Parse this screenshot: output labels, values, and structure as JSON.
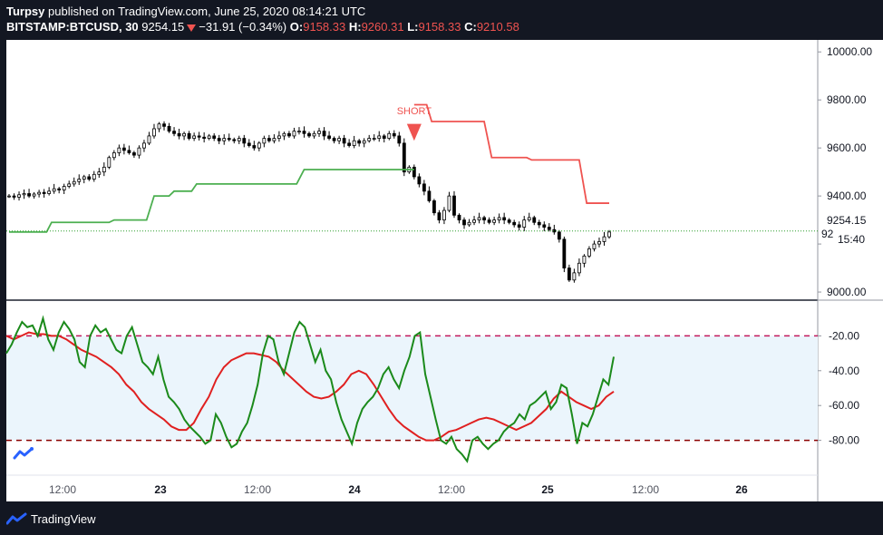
{
  "header": {
    "author": "Turpsy",
    "published": "published on TradingView.com, June 25, 2020 08:14:21 UTC",
    "symbol": "BITSTAMP:BTCUSD, 30",
    "last": "9254.15",
    "change": "−31.91 (−0.34%)",
    "o_label": "O:",
    "o": "9158.33",
    "h_label": "H:",
    "h": "9260.31",
    "l_label": "L:",
    "l": "9158.33",
    "c_label": "C:",
    "c": "9210.58"
  },
  "footer": {
    "brand": "TradingView"
  },
  "colors": {
    "bg": "#131722",
    "up_line": "#4caf50",
    "down_line": "#ef5350",
    "osc_green": "#1b8a1b",
    "osc_red": "#e02020",
    "band": "#ebf5fc",
    "price_line": "#2e9f2e"
  },
  "chart_data": [
    {
      "type": "candlestick",
      "symbol": "BITSTAMP:BTCUSD",
      "interval": "30",
      "ylim": [
        8970,
        10050
      ],
      "y_ticks": [
        9000,
        9200,
        9400,
        9600,
        9800,
        10000
      ],
      "y_tick_labels": [
        "9000.00",
        "",
        "9400.00",
        "9600.00",
        "9800.00",
        "10000.00"
      ],
      "x_ticks": [
        "12:00",
        "23",
        "12:00",
        "24",
        "12:00",
        "25",
        "12:00",
        "26"
      ],
      "last_price_label": "9254.15",
      "countdown_label": "15:40",
      "hidden_label": "92",
      "price_close_series": [
        9400,
        9395,
        9405,
        9410,
        9400,
        9408,
        9415,
        9410,
        9420,
        9430,
        9425,
        9440,
        9450,
        9460,
        9470,
        9480,
        9470,
        9490,
        9500,
        9520,
        9560,
        9580,
        9600,
        9590,
        9580,
        9570,
        9600,
        9620,
        9650,
        9680,
        9700,
        9690,
        9670,
        9660,
        9650,
        9660,
        9640,
        9650,
        9645,
        9640,
        9650,
        9640,
        9630,
        9640,
        9635,
        9630,
        9640,
        9620,
        9610,
        9600,
        9620,
        9640,
        9630,
        9640,
        9650,
        9660,
        9650,
        9670,
        9670,
        9660,
        9650,
        9660,
        9670,
        9650,
        9640,
        9630,
        9640,
        9620,
        9610,
        9630,
        9620,
        9630,
        9640,
        9640,
        9650,
        9640,
        9660,
        9650,
        9620,
        9500,
        9520,
        9480,
        9450,
        9420,
        9380,
        9330,
        9300,
        9340,
        9400,
        9320,
        9300,
        9280,
        9290,
        9300,
        9310,
        9300,
        9290,
        9300,
        9310,
        9300,
        9290,
        9280,
        9270,
        9300,
        9310,
        9290,
        9280,
        9270,
        9260,
        9250,
        9220,
        9100,
        9050,
        9080,
        9120,
        9150,
        9180,
        9200,
        9210,
        9230,
        9250
      ],
      "supertrend_up": {
        "name": "",
        "points": [
          [
            0,
            9250
          ],
          [
            15,
            9250
          ],
          [
            17,
            9290
          ],
          [
            40,
            9290
          ],
          [
            42,
            9300
          ],
          [
            55,
            9300
          ],
          [
            58,
            9400
          ],
          [
            64,
            9400
          ],
          [
            66,
            9420
          ],
          [
            73,
            9420
          ],
          [
            75,
            9450
          ],
          [
            115,
            9450
          ],
          [
            118,
            9510
          ],
          [
            162,
            9510
          ]
        ]
      },
      "supertrend_down": {
        "name": "",
        "points": [
          [
            162,
            9780
          ],
          [
            167,
            9780
          ],
          [
            169,
            9710
          ],
          [
            190,
            9710
          ],
          [
            193,
            9560
          ],
          [
            207,
            9560
          ],
          [
            209,
            9550
          ],
          [
            228,
            9550
          ],
          [
            231,
            9370
          ],
          [
            240,
            9370
          ]
        ]
      },
      "signal_label": "SHORT",
      "signal_x": 162
    },
    {
      "type": "line",
      "name": "oscillator",
      "ylim": [
        -100,
        0
      ],
      "y_ticks": [
        -20,
        -40,
        -60,
        -80
      ],
      "y_tick_labels": [
        "-20.00",
        "-40.00",
        "-60.00",
        "-80.00"
      ],
      "levels": [
        -20,
        -80
      ],
      "fast": [
        -30,
        -25,
        -18,
        -12,
        -15,
        -14,
        -20,
        -10,
        -22,
        -28,
        -18,
        -12,
        -16,
        -22,
        -35,
        -38,
        -20,
        -14,
        -18,
        -16,
        -22,
        -28,
        -30,
        -20,
        -15,
        -25,
        -35,
        -38,
        -42,
        -32,
        -45,
        -55,
        -58,
        -62,
        -68,
        -72,
        -75,
        -78,
        -82,
        -80,
        -65,
        -70,
        -78,
        -84,
        -82,
        -75,
        -70,
        -60,
        -48,
        -30,
        -20,
        -22,
        -35,
        -42,
        -30,
        -18,
        -12,
        -15,
        -25,
        -35,
        -28,
        -40,
        -45,
        -58,
        -68,
        -75,
        -82,
        -70,
        -62,
        -58,
        -55,
        -50,
        -42,
        -38,
        -45,
        -50,
        -40,
        -32,
        -20,
        -18,
        -42,
        -55,
        -68,
        -80,
        -82,
        -78,
        -85,
        -88,
        -92,
        -80,
        -78,
        -82,
        -85,
        -82,
        -80,
        -75,
        -72,
        -70,
        -65,
        -68,
        -60,
        -58,
        -55,
        -52,
        -62,
        -58,
        -48,
        -50,
        -65,
        -82,
        -70,
        -72,
        -65,
        -55,
        -45,
        -48,
        -32
      ],
      "slow": [
        -20,
        -22,
        -20,
        -18,
        -19,
        -19,
        -20,
        -20,
        -22,
        -25,
        -28,
        -30,
        -32,
        -35,
        -38,
        -42,
        -48,
        -52,
        -58,
        -62,
        -65,
        -68,
        -72,
        -74,
        -74,
        -70,
        -62,
        -55,
        -45,
        -38,
        -34,
        -32,
        -30,
        -30,
        -31,
        -32,
        -35,
        -40,
        -44,
        -48,
        -52,
        -55,
        -56,
        -55,
        -52,
        -48,
        -42,
        -40,
        -42,
        -48,
        -55,
        -62,
        -68,
        -72,
        -75,
        -78,
        -80,
        -80,
        -78,
        -75,
        -74,
        -72,
        -70,
        -68,
        -67,
        -68,
        -70,
        -72,
        -74,
        -72,
        -70,
        -66,
        -62,
        -56,
        -52,
        -55,
        -58,
        -60,
        -62,
        -60,
        -55,
        -52
      ]
    }
  ]
}
